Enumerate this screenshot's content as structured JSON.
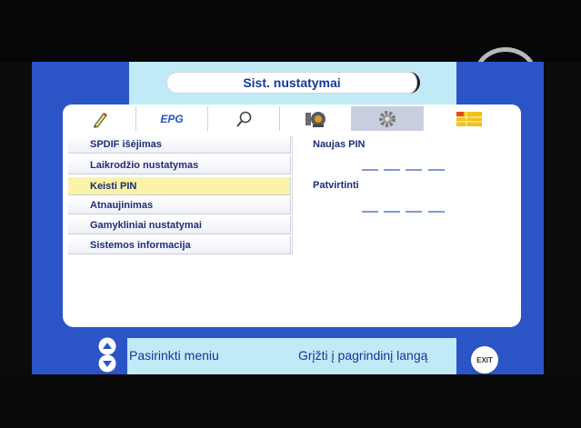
{
  "title": "Sist. nustatymai",
  "tabs": [
    {
      "name": "edit-icon"
    },
    {
      "label": "EPG"
    },
    {
      "name": "search-icon"
    },
    {
      "name": "satellite-dish-icon"
    },
    {
      "name": "gear-icon",
      "active": true
    },
    {
      "name": "info-grid-icon"
    }
  ],
  "menu": [
    {
      "label": "SPDIF išėjimas"
    },
    {
      "label": "Laikrodžio nustatymas"
    },
    {
      "label": "Keisti PIN",
      "selected": true
    },
    {
      "label": "Atnaujinimas"
    },
    {
      "label": "Gamykliniai nustatymai"
    },
    {
      "label": "Sistemos informacija"
    }
  ],
  "right": {
    "new_pin_label": "Naujas PIN",
    "confirm_label": "Patvirtinti"
  },
  "footer": {
    "select_hint": "Pasirinkti meniu",
    "return_hint": "Grįžti į pagrindinį langą",
    "exit_label": "EXIT"
  }
}
